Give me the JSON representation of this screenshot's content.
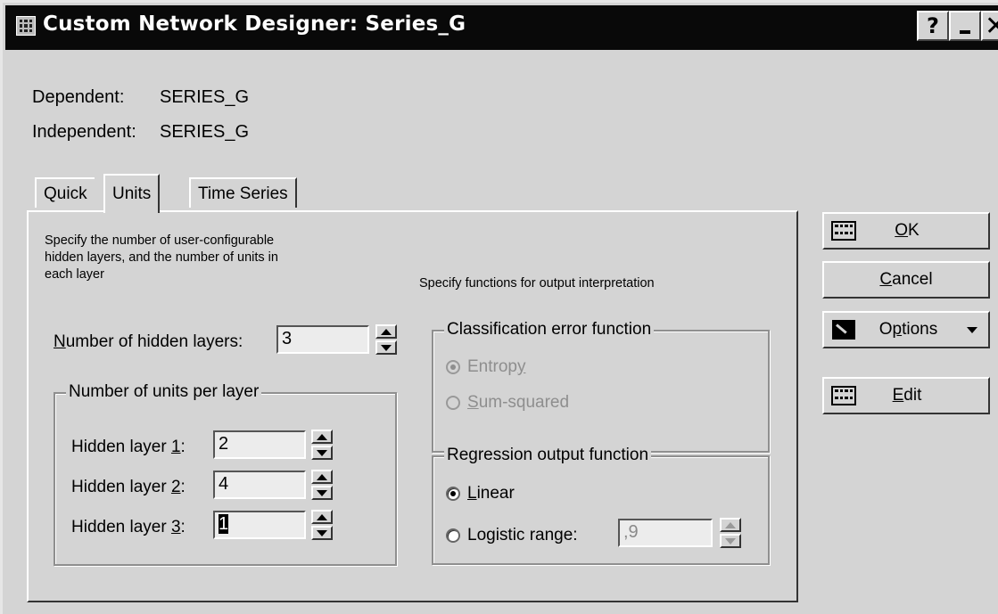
{
  "window": {
    "title": "Custom Network Designer: Series_G",
    "help_label": "?",
    "close_label": "✕"
  },
  "vars": {
    "dependent_label": "Dependent:",
    "dependent_value": "SERIES_G",
    "independent_label": "Independent:",
    "independent_value": "SERIES_G"
  },
  "tabs": [
    {
      "label": "Quick",
      "active": false
    },
    {
      "label": "Units",
      "active": true
    },
    {
      "label": "Time Series",
      "active": false
    }
  ],
  "units": {
    "description_lines": [
      "Specify the number of user-configurable",
      "hidden layers, and the number of units in",
      "each layer"
    ],
    "hidden_layers": {
      "label_prefix": "N",
      "label_rest": "umber of hidden layers:",
      "value": "3"
    },
    "units_group": {
      "legend": "Number of units per layer",
      "layers": [
        {
          "label": "Hidden layer ",
          "key": "1",
          "suffix": ":",
          "value": "2"
        },
        {
          "label": "Hidden layer ",
          "key": "2",
          "suffix": ":",
          "value": "4"
        },
        {
          "label": "Hidden layer ",
          "key": "3",
          "suffix": ":",
          "value": "1"
        }
      ]
    }
  },
  "output": {
    "heading": "Specify functions for output interpretation",
    "classification": {
      "legend": "Classification error function",
      "options": [
        {
          "pre": "Entrop",
          "key": "y",
          "post": "",
          "selected": true,
          "enabled": false
        },
        {
          "pre": "",
          "key": "S",
          "post": "um-squared",
          "selected": false,
          "enabled": false
        }
      ]
    },
    "regression": {
      "legend": "Regression output function",
      "options": [
        {
          "pre": "",
          "key": "L",
          "post": "inear",
          "selected": true,
          "enabled": true
        },
        {
          "pre": "Logistic range:",
          "key": "",
          "post": "",
          "selected": false,
          "enabled": true
        }
      ],
      "range_value": ",9"
    }
  },
  "buttons": {
    "ok": {
      "key": "O",
      "rest": "K"
    },
    "cancel": {
      "key": "C",
      "rest": "ancel"
    },
    "options": {
      "pre": "O",
      "key": "p",
      "rest": "tions"
    },
    "edit": {
      "key": "E",
      "rest": "dit"
    }
  }
}
